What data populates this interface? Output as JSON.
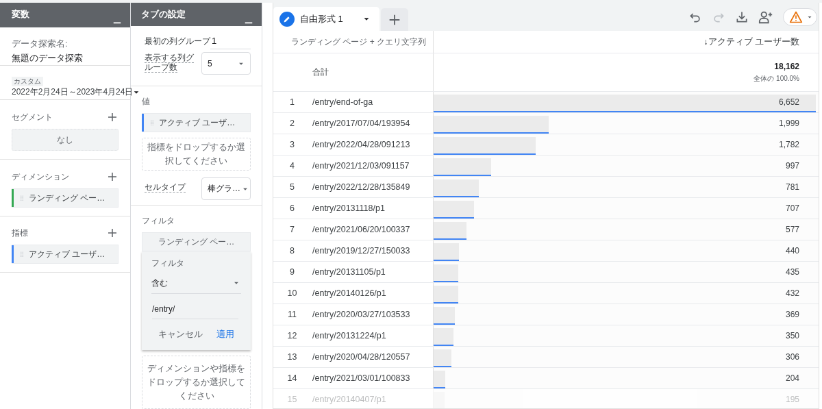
{
  "variables_panel": {
    "title": "変数",
    "name_label": "データ探索名:",
    "name": "無題のデータ探索",
    "date_badge": "カスタム",
    "date_range": "2022年2月24日～2023年4月24日",
    "segments": {
      "title": "セグメント",
      "empty_text": "なし"
    },
    "dimensions": {
      "title": "ディメンション",
      "items": [
        {
          "label": "ランディング ペー…",
          "color": "#34a853"
        }
      ]
    },
    "metrics": {
      "title": "指標",
      "items": [
        {
          "label": "アクティブ ユーザ…",
          "color": "#4285f4"
        }
      ]
    }
  },
  "tab_settings": {
    "title": "タブの設定",
    "first_column_group": {
      "label": "最初の列グループ",
      "value": "1"
    },
    "column_groups": {
      "label": "表示する列グループ数",
      "value": "5"
    },
    "values": {
      "title": "値",
      "items": [
        {
          "label": "アクティブ ユーザ…",
          "color": "#4285f4"
        }
      ],
      "drop_hint": "指標をドロップするか選択してください"
    },
    "cell_type": {
      "label": "セルタイプ",
      "value": "棒グラ…"
    },
    "filters": {
      "title": "フィルタ",
      "items": [
        {
          "label": "ランディング ペー…",
          "expanded": true
        }
      ],
      "editor": {
        "title": "フィルタ",
        "condition": "含む",
        "value": "/entry/",
        "cancel": "キャンセル",
        "apply": "適用"
      },
      "drop_hint": "ディメンションや指標をドロップするか選択してください"
    }
  },
  "tabs": [
    {
      "label": "自由形式 1",
      "selected": true
    }
  ],
  "table": {
    "columns": [
      {
        "label": "ランディング ページ + クエリ文字列"
      },
      {
        "label": "↓アクティブ ユーザー数"
      }
    ],
    "total": {
      "label": "合計",
      "value": "18,162",
      "share": "全体の 100.0%"
    },
    "rows": [
      {
        "index": "1",
        "page": "/entry/end-of-ga",
        "value": "6,652",
        "level": 1.0,
        "faded": false
      },
      {
        "index": "2",
        "page": "/entry/2017/07/04/193954",
        "value": "1,999",
        "level": 0.3005,
        "faded": false
      },
      {
        "index": "3",
        "page": "/entry/2022/04/28/091213",
        "value": "1,782",
        "level": 0.2679,
        "faded": false
      },
      {
        "index": "4",
        "page": "/entry/2021/12/03/091157",
        "value": "997",
        "level": 0.1499,
        "faded": false
      },
      {
        "index": "5",
        "page": "/entry/2022/12/28/135849",
        "value": "781",
        "level": 0.1174,
        "faded": false
      },
      {
        "index": "6",
        "page": "/entry/20131118/p1",
        "value": "707",
        "level": 0.1063,
        "faded": false
      },
      {
        "index": "7",
        "page": "/entry/2021/06/20/100337",
        "value": "577",
        "level": 0.0867,
        "faded": false
      },
      {
        "index": "8",
        "page": "/entry/2019/12/27/150033",
        "value": "440",
        "level": 0.0661,
        "faded": false
      },
      {
        "index": "9",
        "page": "/entry/20131105/p1",
        "value": "435",
        "level": 0.0654,
        "faded": false
      },
      {
        "index": "10",
        "page": "/entry/20140126/p1",
        "value": "432",
        "level": 0.0649,
        "faded": false
      },
      {
        "index": "11",
        "page": "/entry/2020/03/27/103533",
        "value": "369",
        "level": 0.0555,
        "faded": false
      },
      {
        "index": "12",
        "page": "/entry/20131224/p1",
        "value": "350",
        "level": 0.0526,
        "faded": false
      },
      {
        "index": "13",
        "page": "/entry/2020/04/28/120557",
        "value": "306",
        "level": 0.046,
        "faded": false
      },
      {
        "index": "14",
        "page": "/entry/2021/03/01/100833",
        "value": "204",
        "level": 0.0307,
        "faded": false
      },
      {
        "index": "15",
        "page": "/entry/20140407/p1",
        "value": "195",
        "level": 0.0293,
        "faded": true
      }
    ]
  }
}
